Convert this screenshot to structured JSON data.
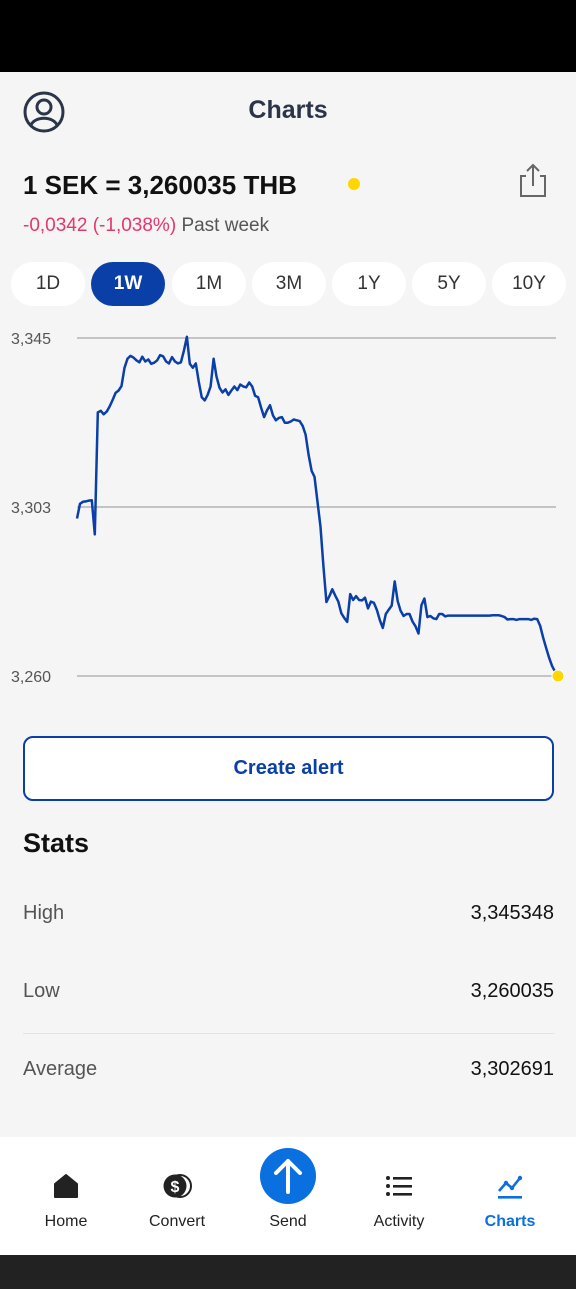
{
  "header": {
    "title": "Charts"
  },
  "rate": {
    "text": "1 SEK = 3,260035 THB",
    "change": "-0,0342 (-1,038%)",
    "period": "Past week",
    "dot_color": "#ffd600"
  },
  "ranges": [
    {
      "label": "1D",
      "active": false
    },
    {
      "label": "1W",
      "active": true
    },
    {
      "label": "1M",
      "active": false
    },
    {
      "label": "3M",
      "active": false
    },
    {
      "label": "1Y",
      "active": false
    },
    {
      "label": "5Y",
      "active": false
    },
    {
      "label": "10Y",
      "active": false
    }
  ],
  "chart_data": {
    "type": "line",
    "y_ticks": [
      "3,345",
      "3,303",
      "3,260"
    ],
    "ylim": [
      3.26,
      3.345
    ],
    "grid": true,
    "line_color": "#0a3fa8",
    "end_marker_color": "#ffd600",
    "series": [
      {
        "values": [
          3.2996,
          3.3033,
          3.3038,
          3.3039,
          3.3041,
          3.3042,
          3.2956,
          3.3263,
          3.3267,
          3.3258,
          3.3265,
          3.3278,
          3.3294,
          3.3312,
          3.3318,
          3.3329,
          3.3375,
          3.3398,
          3.3405,
          3.3401,
          3.3394,
          3.3389,
          3.3403,
          3.3391,
          3.3396,
          3.3385,
          3.3388,
          3.3394,
          3.3407,
          3.3404,
          3.3391,
          3.3386,
          3.3402,
          3.3391,
          3.3386,
          3.3389,
          3.3418,
          3.3453,
          3.3385,
          3.3375,
          3.3386,
          3.3341,
          3.3301,
          3.3293,
          3.3307,
          3.3328,
          3.3398,
          3.3353,
          3.3325,
          3.3313,
          3.3321,
          3.3307,
          3.3318,
          3.3328,
          3.3319,
          3.3333,
          3.3328,
          3.3326,
          3.3338,
          3.3328,
          3.3305,
          3.3301,
          3.3275,
          3.3251,
          3.3268,
          3.3281,
          3.3255,
          3.3243,
          3.3249,
          3.3251,
          3.3237,
          3.3237,
          3.324,
          3.3245,
          3.3243,
          3.3241,
          3.3229,
          3.3207,
          3.3156,
          3.3116,
          3.3101,
          3.3038,
          3.2975,
          3.2877,
          3.2786,
          3.2801,
          3.2818,
          3.2802,
          3.2787,
          3.2758,
          3.2746,
          3.2736,
          3.2806,
          3.2791,
          3.2801,
          3.2791,
          3.279,
          3.2797,
          3.277,
          3.2787,
          3.2784,
          3.2766,
          3.274,
          3.2721,
          3.2756,
          3.2767,
          3.2777,
          3.2838,
          3.2788,
          3.2764,
          3.2751,
          3.2756,
          3.2756,
          3.2737,
          3.2725,
          3.2707,
          3.2778,
          3.2795,
          3.2748,
          3.2751,
          3.2745,
          3.2743,
          3.2756,
          3.2756,
          3.275,
          3.2752,
          3.2752,
          3.2752,
          3.2752,
          3.2752,
          3.2752,
          3.2752,
          3.2752,
          3.2752,
          3.2752,
          3.2752,
          3.2752,
          3.2752,
          3.2752,
          3.2752,
          3.2753,
          3.2753,
          3.2753,
          3.2751,
          3.2748,
          3.2742,
          3.2743,
          3.2743,
          3.2741,
          3.2743,
          3.2743,
          3.2743,
          3.2743,
          3.2741,
          3.2744,
          3.2743,
          3.2726,
          3.2696,
          3.2671,
          3.2646,
          3.2625,
          3.2611,
          3.26
        ]
      }
    ]
  },
  "alert": {
    "label": "Create alert"
  },
  "stats": {
    "title": "Stats",
    "rows": [
      {
        "label": "High",
        "value": "3,345348"
      },
      {
        "label": "Low",
        "value": "3,260035"
      },
      {
        "label": "Average",
        "value": "3,302691"
      }
    ]
  },
  "nav": {
    "items": [
      {
        "label": "Home",
        "icon": "home-icon"
      },
      {
        "label": "Convert",
        "icon": "dollar-coins-icon"
      },
      {
        "label": "Send",
        "icon": "arrow-up-icon"
      },
      {
        "label": "Activity",
        "icon": "list-icon"
      },
      {
        "label": "Charts",
        "icon": "chart-line-icon",
        "active": true
      }
    ],
    "active_color": "#0a6fdf"
  }
}
